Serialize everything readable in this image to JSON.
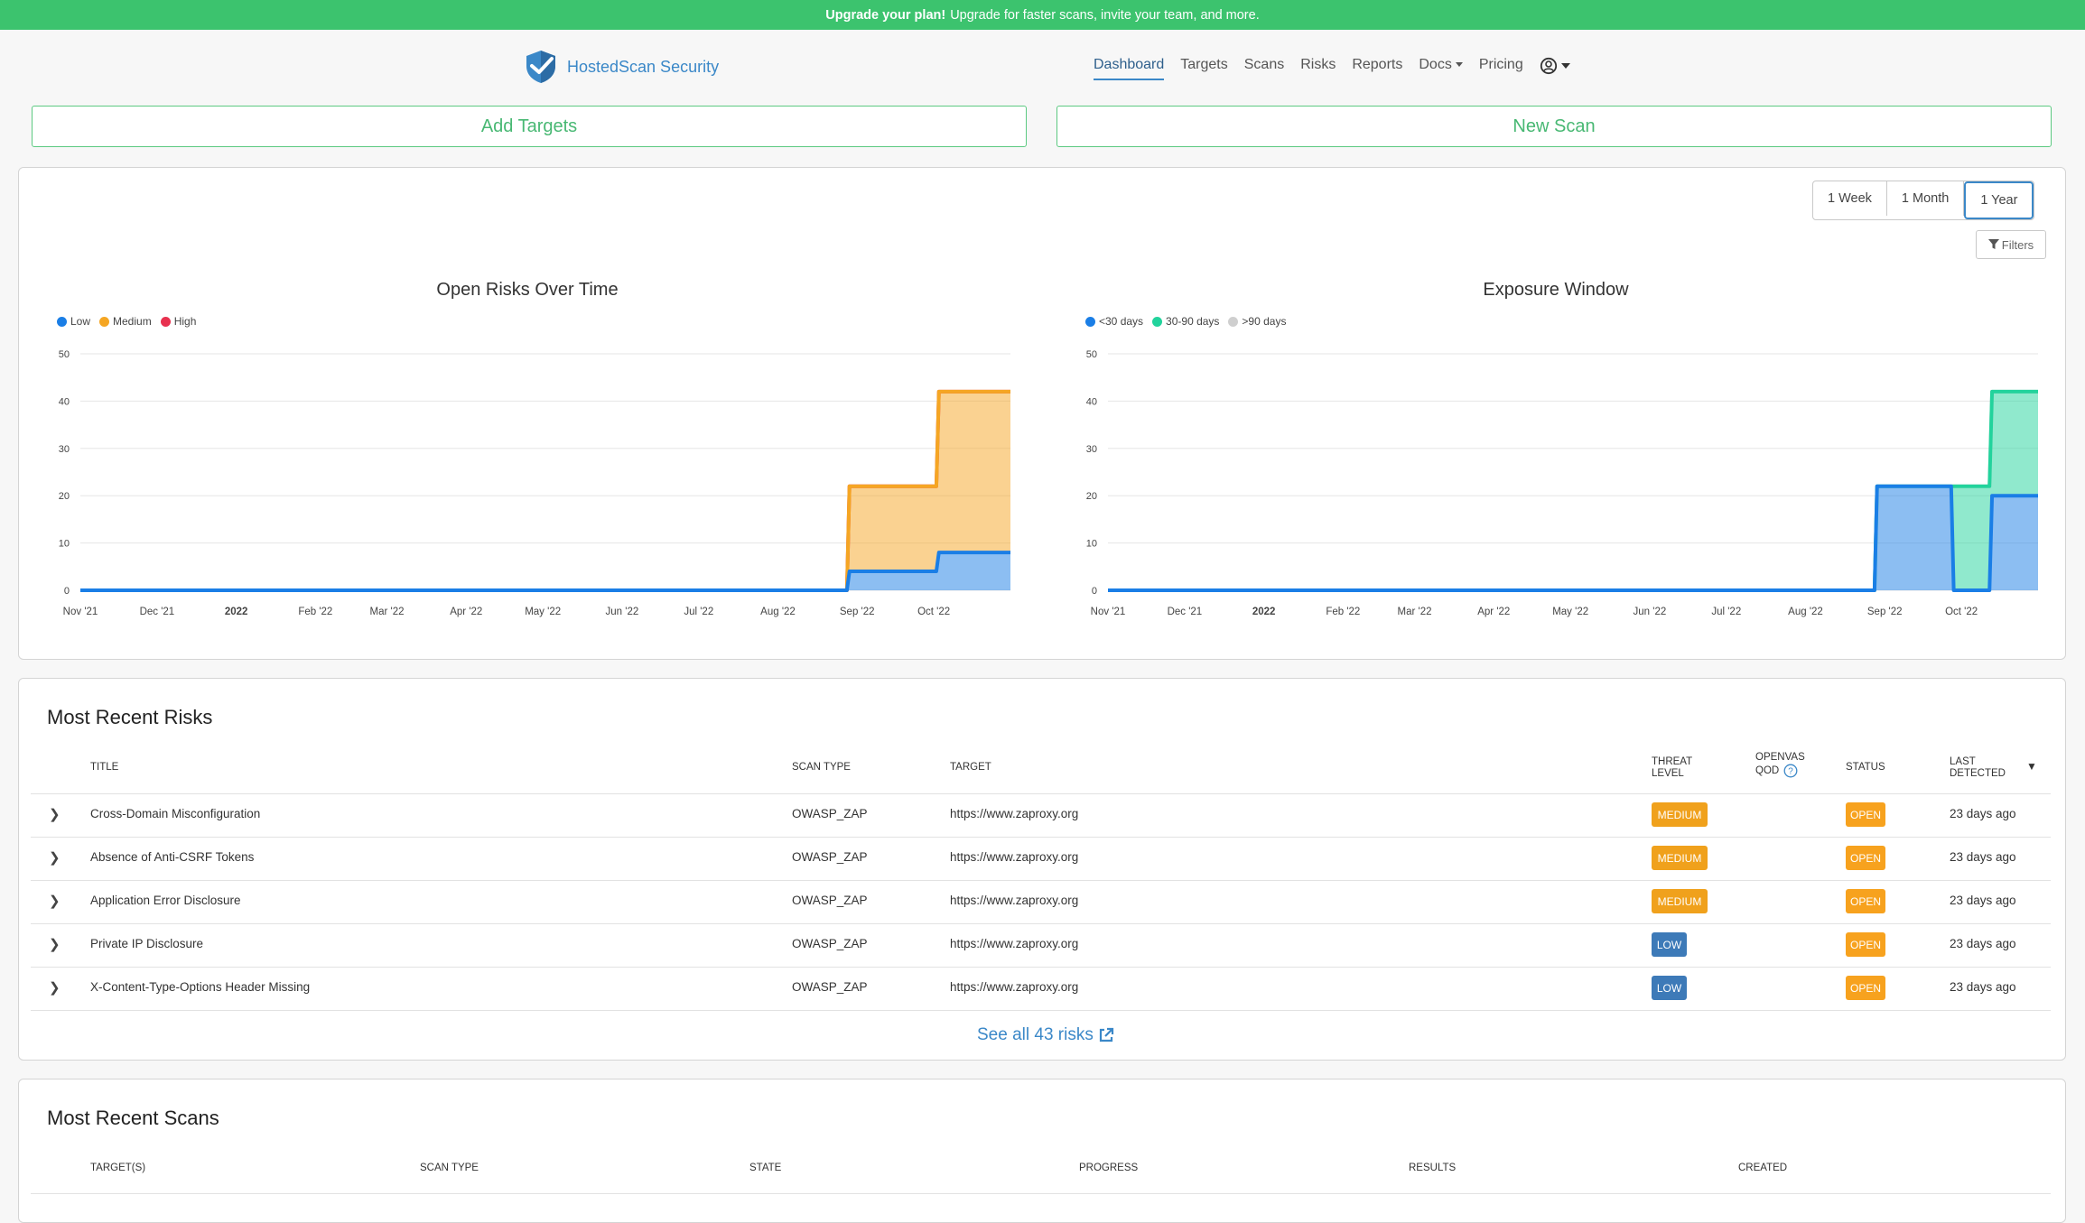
{
  "banner": {
    "bold": "Upgrade your plan!",
    "text": "Upgrade for faster scans, invite your team, and more."
  },
  "brand": {
    "name": "HostedScan Security"
  },
  "nav": {
    "items": [
      "Dashboard",
      "Targets",
      "Scans",
      "Risks",
      "Reports",
      "Docs",
      "Pricing"
    ],
    "active": "Dashboard"
  },
  "actions": {
    "add_targets": "Add Targets",
    "new_scan": "New Scan"
  },
  "range": {
    "options": [
      "1 Week",
      "1 Month",
      "1 Year"
    ],
    "selected": "1 Year"
  },
  "filters_label": "Filters",
  "colors": {
    "brand": "#3b88c8",
    "green": "#3cc36e",
    "low": "#1a7ee6",
    "medium": "#f5a623",
    "high": "#e8314f",
    "lt30": "#1a7ee6",
    "d30_90": "#22d39c",
    "gt90": "#cfcfcf"
  },
  "chart_data": [
    {
      "type": "area",
      "title": "Open Risks Over Time",
      "xticks": [
        "Nov '21",
        "Dec '21",
        "2022",
        "Feb '22",
        "Mar '22",
        "Apr '22",
        "May '22",
        "Jun '22",
        "Jul '22",
        "Aug '22",
        "Sep '22",
        "Oct '22"
      ],
      "ylim": [
        0,
        50
      ],
      "yticks": [
        0,
        10,
        20,
        30,
        40,
        50
      ],
      "stacked": true,
      "grid": true,
      "legend_position": "top-left",
      "x": [
        "2021-11-01",
        "2022-08-28",
        "2022-08-29",
        "2022-10-02",
        "2022-10-03",
        "2022-10-31"
      ],
      "series": [
        {
          "name": "Low",
          "color": "#1a7ee6",
          "values": [
            0,
            0,
            4,
            4,
            8,
            8
          ]
        },
        {
          "name": "Medium",
          "color": "#f5a623",
          "values": [
            0,
            0,
            18,
            18,
            34,
            34
          ]
        },
        {
          "name": "High",
          "color": "#e8314f",
          "values": [
            0,
            0,
            0,
            0,
            0,
            0
          ]
        }
      ]
    },
    {
      "type": "area",
      "title": "Exposure Window",
      "xticks": [
        "Nov '21",
        "Dec '21",
        "2022",
        "Feb '22",
        "Mar '22",
        "Apr '22",
        "May '22",
        "Jun '22",
        "Jul '22",
        "Aug '22",
        "Sep '22",
        "Oct '22"
      ],
      "ylim": [
        0,
        50
      ],
      "yticks": [
        0,
        10,
        20,
        30,
        40,
        50
      ],
      "stacked": true,
      "grid": true,
      "legend_position": "top-left",
      "x": [
        "2021-11-01",
        "2022-08-28",
        "2022-08-29",
        "2022-09-27",
        "2022-09-28",
        "2022-10-12",
        "2022-10-13",
        "2022-10-31"
      ],
      "series": [
        {
          "name": "<30 days",
          "color": "#1a7ee6",
          "values": [
            0,
            0,
            22,
            22,
            0,
            0,
            20,
            20
          ]
        },
        {
          "name": "30-90 days",
          "color": "#22d39c",
          "values": [
            0,
            0,
            0,
            0,
            22,
            22,
            22,
            22
          ]
        },
        {
          "name": ">90 days",
          "color": "#cfcfcf",
          "values": [
            0,
            0,
            0,
            0,
            0,
            0,
            0,
            0
          ]
        }
      ]
    }
  ],
  "risks": {
    "title": "Most Recent Risks",
    "headers": {
      "title": "TITLE",
      "scan_type": "SCAN TYPE",
      "target": "TARGET",
      "threat_level_1": "THREAT",
      "threat_level_2": "LEVEL",
      "openvas_1": "OPENVAS",
      "openvas_2": "QOD",
      "status": "STATUS",
      "last_detected_1": "LAST",
      "last_detected_2": "DETECTED"
    },
    "rows": [
      {
        "title": "Cross-Domain Misconfiguration",
        "scan_type": "OWASP_ZAP",
        "target": "https://www.zaproxy.org",
        "threat": "MEDIUM",
        "status": "OPEN",
        "last": "23 days ago"
      },
      {
        "title": "Absence of Anti-CSRF Tokens",
        "scan_type": "OWASP_ZAP",
        "target": "https://www.zaproxy.org",
        "threat": "MEDIUM",
        "status": "OPEN",
        "last": "23 days ago"
      },
      {
        "title": "Application Error Disclosure",
        "scan_type": "OWASP_ZAP",
        "target": "https://www.zaproxy.org",
        "threat": "MEDIUM",
        "status": "OPEN",
        "last": "23 days ago"
      },
      {
        "title": "Private IP Disclosure",
        "scan_type": "OWASP_ZAP",
        "target": "https://www.zaproxy.org",
        "threat": "LOW",
        "status": "OPEN",
        "last": "23 days ago"
      },
      {
        "title": "X-Content-Type-Options Header Missing",
        "scan_type": "OWASP_ZAP",
        "target": "https://www.zaproxy.org",
        "threat": "LOW",
        "status": "OPEN",
        "last": "23 days ago"
      }
    ],
    "see_all": "See all 43 risks"
  },
  "scans": {
    "title": "Most Recent Scans",
    "headers": [
      "TARGET(S)",
      "SCAN TYPE",
      "STATE",
      "PROGRESS",
      "RESULTS",
      "CREATED"
    ]
  }
}
